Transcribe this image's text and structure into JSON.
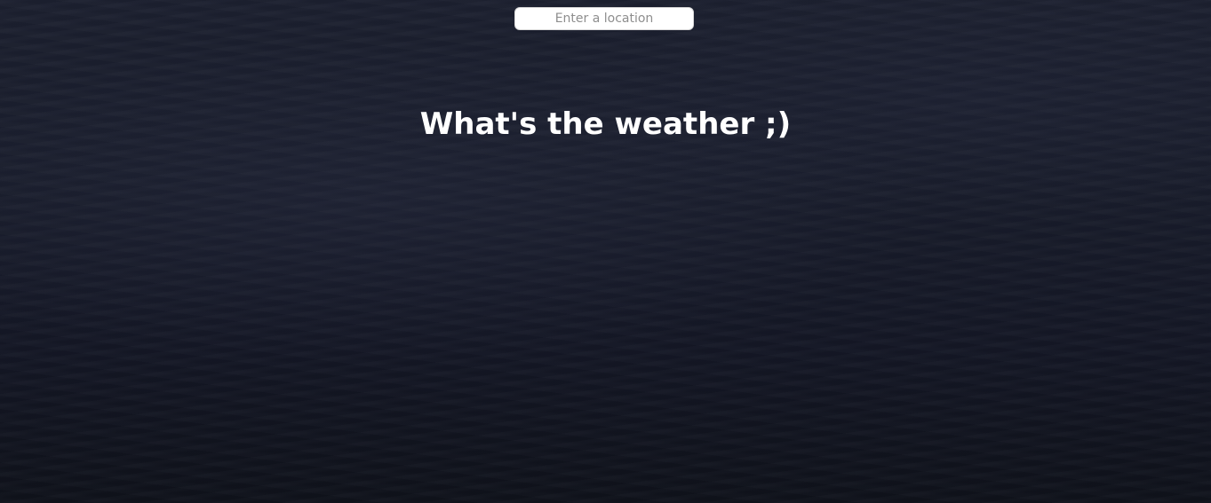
{
  "search": {
    "placeholder": "Enter a location",
    "value": ""
  },
  "main": {
    "title": "What's the weather ;)"
  },
  "colors": {
    "background": "#161a27",
    "title_text": "#ffffff",
    "input_background": "#ffffff",
    "placeholder_text": "#8e8e8e"
  }
}
